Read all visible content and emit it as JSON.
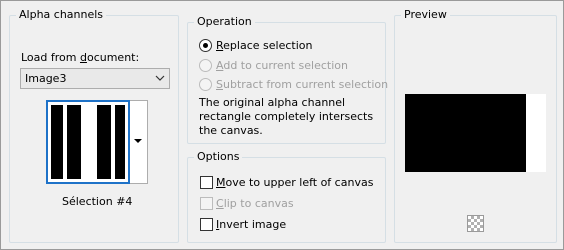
{
  "alpha": {
    "group_title": "Alpha channels",
    "load_label_pre": "Load from ",
    "load_label_u": "d",
    "load_label_post": "ocument:",
    "document_value": "Image3",
    "selection_caption": "Sélection #4"
  },
  "operation": {
    "group_title": "Operation",
    "options": [
      {
        "u": "R",
        "rest": "eplace selection",
        "selected": true,
        "enabled": true
      },
      {
        "u": "A",
        "rest": "dd to current selection",
        "selected": false,
        "enabled": false
      },
      {
        "u": "S",
        "rest": "ubtract from current selection",
        "selected": false,
        "enabled": false
      }
    ],
    "description": "The original alpha channel rectangle completely intersects the canvas."
  },
  "options": {
    "group_title": "Options",
    "items": [
      {
        "u": "M",
        "rest": "ove to upper left of canvas",
        "checked": false,
        "enabled": true
      },
      {
        "u": "C",
        "rest": "lip to canvas",
        "checked": false,
        "enabled": false
      },
      {
        "u": "I",
        "rest": "nvert image",
        "checked": false,
        "enabled": true
      }
    ]
  },
  "preview": {
    "group_title": "Preview",
    "zoom_icon": "checkerboard-icon"
  },
  "colors": {
    "accent": "#1e72c8",
    "group_border": "#d5dfe5",
    "background": "#f0f0f0"
  }
}
